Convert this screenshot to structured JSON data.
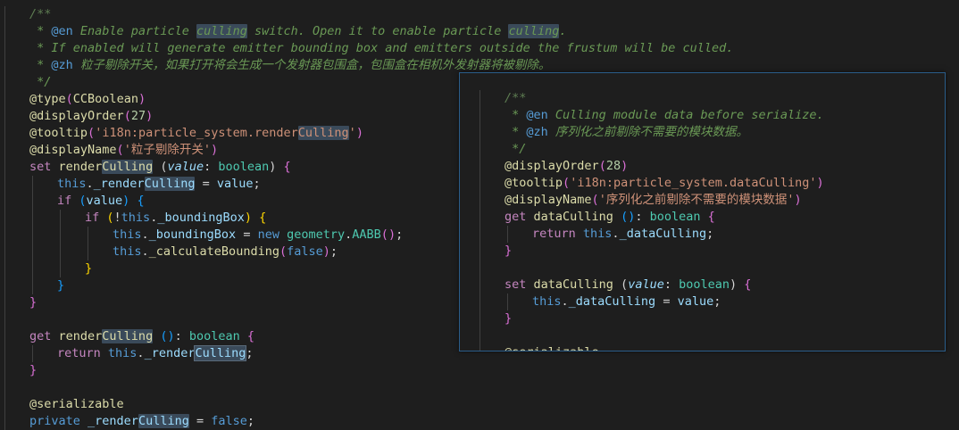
{
  "main_code": {
    "lines": [
      {
        "indent": 1,
        "segments": [
          {
            "t": "/**",
            "c": "comment-dim"
          }
        ]
      },
      {
        "indent": 1,
        "segments": [
          {
            "t": " * ",
            "c": "comment"
          },
          {
            "t": "@en",
            "c": "tag"
          },
          {
            "t": " Enable particle ",
            "c": "comment"
          },
          {
            "t": "culling",
            "c": "comment hl"
          },
          {
            "t": " switch. Open it to enable particle ",
            "c": "comment"
          },
          {
            "t": "culling",
            "c": "comment hl"
          },
          {
            "t": ".",
            "c": "comment"
          }
        ]
      },
      {
        "indent": 1,
        "segments": [
          {
            "t": " * If enabled will generate emitter bounding box and emitters outside the frustum will be culled.",
            "c": "comment"
          }
        ]
      },
      {
        "indent": 1,
        "segments": [
          {
            "t": " * ",
            "c": "comment"
          },
          {
            "t": "@zh",
            "c": "tag"
          },
          {
            "t": " 粒子剔除开关，如果打开将会生成一个发射器包围盒，包围盒在相机外发射器将被剔除。",
            "c": "comment"
          }
        ]
      },
      {
        "indent": 1,
        "segments": [
          {
            "t": " */",
            "c": "comment"
          }
        ]
      },
      {
        "indent": 1,
        "segments": [
          {
            "t": "@",
            "c": "deco"
          },
          {
            "t": "type",
            "c": "fn"
          },
          {
            "t": "(",
            "c": "brace-p"
          },
          {
            "t": "CCBoolean",
            "c": "fn"
          },
          {
            "t": ")",
            "c": "brace-p"
          }
        ]
      },
      {
        "indent": 1,
        "segments": [
          {
            "t": "@",
            "c": "deco"
          },
          {
            "t": "displayOrder",
            "c": "fn"
          },
          {
            "t": "(",
            "c": "brace-p"
          },
          {
            "t": "27",
            "c": "num"
          },
          {
            "t": ")",
            "c": "brace-p"
          }
        ]
      },
      {
        "indent": 1,
        "segments": [
          {
            "t": "@",
            "c": "deco"
          },
          {
            "t": "tooltip",
            "c": "fn"
          },
          {
            "t": "(",
            "c": "brace-p"
          },
          {
            "t": "'i18n:particle_system.render",
            "c": "str"
          },
          {
            "t": "Culling",
            "c": "str hl"
          },
          {
            "t": "'",
            "c": "str"
          },
          {
            "t": ")",
            "c": "brace-p"
          }
        ]
      },
      {
        "indent": 1,
        "segments": [
          {
            "t": "@",
            "c": "deco"
          },
          {
            "t": "displayName",
            "c": "fn"
          },
          {
            "t": "(",
            "c": "brace-p"
          },
          {
            "t": "'粒子剔除开关'",
            "c": "str"
          },
          {
            "t": ")",
            "c": "brace-p"
          }
        ]
      },
      {
        "indent": 1,
        "segments": [
          {
            "t": "set ",
            "c": "kw"
          },
          {
            "t": "render",
            "c": "fn"
          },
          {
            "t": "Culling",
            "c": "fn hl"
          },
          {
            "t": " (",
            "c": "punc"
          },
          {
            "t": "value",
            "c": "param"
          },
          {
            "t": ": ",
            "c": "punc"
          },
          {
            "t": "boolean",
            "c": "kwtype"
          },
          {
            "t": ") ",
            "c": "punc"
          },
          {
            "t": "{",
            "c": "brace-p"
          }
        ]
      },
      {
        "indent": 2,
        "segments": [
          {
            "t": "this",
            "c": "kw-blue"
          },
          {
            "t": ".",
            "c": "punc"
          },
          {
            "t": "_render",
            "c": "prop"
          },
          {
            "t": "Culling",
            "c": "prop hl"
          },
          {
            "t": " = ",
            "c": "punc"
          },
          {
            "t": "value",
            "c": "prop"
          },
          {
            "t": ";",
            "c": "punc"
          }
        ]
      },
      {
        "indent": 2,
        "segments": [
          {
            "t": "if ",
            "c": "kw"
          },
          {
            "t": "(",
            "c": "brace-b"
          },
          {
            "t": "value",
            "c": "prop"
          },
          {
            "t": ")",
            "c": "brace-b"
          },
          {
            "t": " ",
            "c": "punc"
          },
          {
            "t": "{",
            "c": "brace-b"
          }
        ]
      },
      {
        "indent": 3,
        "segments": [
          {
            "t": "if ",
            "c": "kw"
          },
          {
            "t": "(",
            "c": "brace-y"
          },
          {
            "t": "!",
            "c": "punc"
          },
          {
            "t": "this",
            "c": "kw-blue"
          },
          {
            "t": ".",
            "c": "punc"
          },
          {
            "t": "_boundingBox",
            "c": "prop"
          },
          {
            "t": ")",
            "c": "brace-y"
          },
          {
            "t": " ",
            "c": "punc"
          },
          {
            "t": "{",
            "c": "brace-y"
          }
        ]
      },
      {
        "indent": 4,
        "segments": [
          {
            "t": "this",
            "c": "kw-blue"
          },
          {
            "t": ".",
            "c": "punc"
          },
          {
            "t": "_boundingBox",
            "c": "prop"
          },
          {
            "t": " = ",
            "c": "punc"
          },
          {
            "t": "new ",
            "c": "kw-blue"
          },
          {
            "t": "geometry",
            "c": "type"
          },
          {
            "t": ".",
            "c": "punc"
          },
          {
            "t": "AABB",
            "c": "type"
          },
          {
            "t": "(",
            "c": "brace-p"
          },
          {
            "t": ")",
            "c": "brace-p"
          },
          {
            "t": ";",
            "c": "punc"
          }
        ]
      },
      {
        "indent": 4,
        "segments": [
          {
            "t": "this",
            "c": "kw-blue"
          },
          {
            "t": ".",
            "c": "punc"
          },
          {
            "t": "_calculateBounding",
            "c": "fn"
          },
          {
            "t": "(",
            "c": "brace-p"
          },
          {
            "t": "false",
            "c": "kw-blue"
          },
          {
            "t": ")",
            "c": "brace-p"
          },
          {
            "t": ";",
            "c": "punc"
          }
        ]
      },
      {
        "indent": 3,
        "segments": [
          {
            "t": "}",
            "c": "brace-y"
          }
        ]
      },
      {
        "indent": 2,
        "segments": [
          {
            "t": "}",
            "c": "brace-b"
          }
        ]
      },
      {
        "indent": 1,
        "segments": [
          {
            "t": "}",
            "c": "brace-p"
          }
        ]
      },
      {
        "indent": 1,
        "segments": []
      },
      {
        "indent": 1,
        "segments": [
          {
            "t": "get ",
            "c": "kw"
          },
          {
            "t": "render",
            "c": "fn"
          },
          {
            "t": "Culling",
            "c": "fn hl"
          },
          {
            "t": " ",
            "c": "punc"
          },
          {
            "t": "()",
            "c": "brace-b"
          },
          {
            "t": ": ",
            "c": "punc"
          },
          {
            "t": "boolean",
            "c": "kwtype"
          },
          {
            "t": " ",
            "c": "punc"
          },
          {
            "t": "{",
            "c": "brace-p"
          }
        ]
      },
      {
        "indent": 2,
        "segments": [
          {
            "t": "return ",
            "c": "kw"
          },
          {
            "t": "this",
            "c": "kw-blue"
          },
          {
            "t": ".",
            "c": "punc"
          },
          {
            "t": "_render",
            "c": "prop"
          },
          {
            "t": "Culling",
            "c": "prop hl-box"
          },
          {
            "t": ";",
            "c": "punc"
          }
        ]
      },
      {
        "indent": 1,
        "segments": [
          {
            "t": "}",
            "c": "brace-p"
          }
        ]
      },
      {
        "indent": 1,
        "segments": []
      },
      {
        "indent": 1,
        "segments": [
          {
            "t": "@",
            "c": "deco"
          },
          {
            "t": "serializable",
            "c": "fn"
          }
        ]
      },
      {
        "indent": 1,
        "segments": [
          {
            "t": "private ",
            "c": "kw-blue"
          },
          {
            "t": "_render",
            "c": "prop"
          },
          {
            "t": "Culling",
            "c": "prop hl"
          },
          {
            "t": " = ",
            "c": "punc"
          },
          {
            "t": "false",
            "c": "kw-blue"
          },
          {
            "t": ";",
            "c": "punc"
          }
        ]
      }
    ]
  },
  "peek_code": {
    "lines": [
      {
        "indent": 1,
        "segments": [
          {
            "t": "/**",
            "c": "comment-dim"
          }
        ]
      },
      {
        "indent": 1,
        "segments": [
          {
            "t": " * ",
            "c": "comment"
          },
          {
            "t": "@en",
            "c": "tag"
          },
          {
            "t": " Culling module data before serialize.",
            "c": "comment"
          }
        ]
      },
      {
        "indent": 1,
        "segments": [
          {
            "t": " * ",
            "c": "comment"
          },
          {
            "t": "@zh",
            "c": "tag"
          },
          {
            "t": " 序列化之前剔除不需要的模块数据。",
            "c": "comment"
          }
        ]
      },
      {
        "indent": 1,
        "segments": [
          {
            "t": " */",
            "c": "comment"
          }
        ]
      },
      {
        "indent": 1,
        "segments": [
          {
            "t": "@",
            "c": "deco"
          },
          {
            "t": "displayOrder",
            "c": "fn"
          },
          {
            "t": "(",
            "c": "brace-p"
          },
          {
            "t": "28",
            "c": "num"
          },
          {
            "t": ")",
            "c": "brace-p"
          }
        ]
      },
      {
        "indent": 1,
        "segments": [
          {
            "t": "@",
            "c": "deco"
          },
          {
            "t": "tooltip",
            "c": "fn"
          },
          {
            "t": "(",
            "c": "brace-p"
          },
          {
            "t": "'i18n:particle_system.dataCulling'",
            "c": "str"
          },
          {
            "t": ")",
            "c": "brace-p"
          }
        ]
      },
      {
        "indent": 1,
        "segments": [
          {
            "t": "@",
            "c": "deco"
          },
          {
            "t": "displayName",
            "c": "fn"
          },
          {
            "t": "(",
            "c": "brace-p"
          },
          {
            "t": "'序列化之前剔除不需要的模块数据'",
            "c": "str"
          },
          {
            "t": ")",
            "c": "brace-p"
          }
        ]
      },
      {
        "indent": 1,
        "segments": [
          {
            "t": "get ",
            "c": "kw"
          },
          {
            "t": "dataCulling",
            "c": "fn"
          },
          {
            "t": " ",
            "c": "punc"
          },
          {
            "t": "()",
            "c": "brace-b"
          },
          {
            "t": ": ",
            "c": "punc"
          },
          {
            "t": "boolean",
            "c": "kwtype"
          },
          {
            "t": " ",
            "c": "punc"
          },
          {
            "t": "{",
            "c": "brace-p"
          }
        ]
      },
      {
        "indent": 2,
        "segments": [
          {
            "t": "return ",
            "c": "kw"
          },
          {
            "t": "this",
            "c": "kw-blue"
          },
          {
            "t": ".",
            "c": "punc"
          },
          {
            "t": "_dataCulling",
            "c": "prop"
          },
          {
            "t": ";",
            "c": "punc"
          }
        ]
      },
      {
        "indent": 1,
        "segments": [
          {
            "t": "}",
            "c": "brace-p"
          }
        ]
      },
      {
        "indent": 1,
        "segments": []
      },
      {
        "indent": 1,
        "segments": [
          {
            "t": "set ",
            "c": "kw"
          },
          {
            "t": "dataCulling",
            "c": "fn"
          },
          {
            "t": " (",
            "c": "punc"
          },
          {
            "t": "value",
            "c": "param"
          },
          {
            "t": ": ",
            "c": "punc"
          },
          {
            "t": "boolean",
            "c": "kwtype"
          },
          {
            "t": ") ",
            "c": "punc"
          },
          {
            "t": "{",
            "c": "brace-p"
          }
        ]
      },
      {
        "indent": 2,
        "segments": [
          {
            "t": "this",
            "c": "kw-blue"
          },
          {
            "t": ".",
            "c": "punc"
          },
          {
            "t": "_dataCulling",
            "c": "prop"
          },
          {
            "t": " = ",
            "c": "punc"
          },
          {
            "t": "value",
            "c": "prop"
          },
          {
            "t": ";",
            "c": "punc"
          }
        ]
      },
      {
        "indent": 1,
        "segments": [
          {
            "t": "}",
            "c": "brace-p"
          }
        ]
      },
      {
        "indent": 1,
        "segments": []
      },
      {
        "indent": 1,
        "segments": [
          {
            "t": "@serializable",
            "c": "deco"
          }
        ]
      }
    ]
  }
}
